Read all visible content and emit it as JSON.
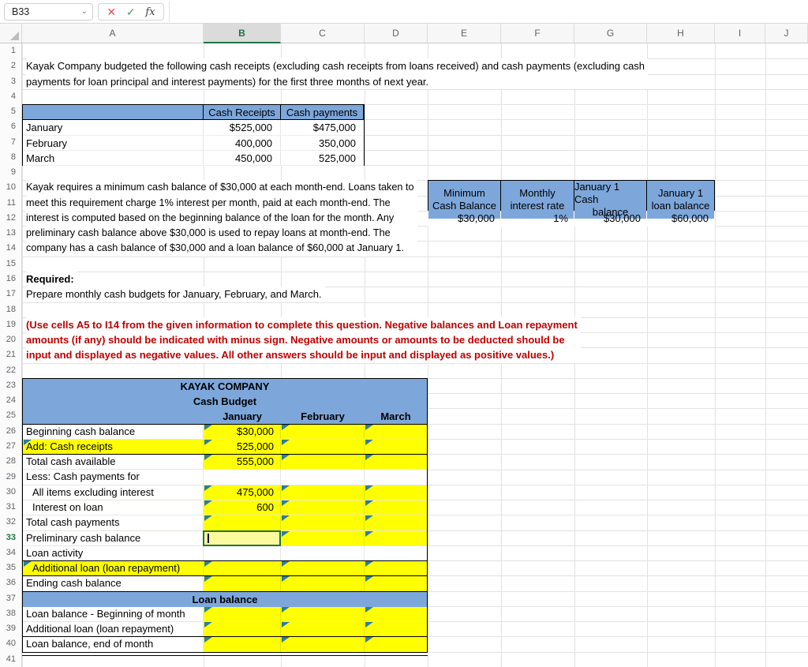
{
  "toolbar": {
    "name_box": "B33",
    "formula_value": "",
    "icons": {
      "chevron": "⌄",
      "cancel": "✕",
      "confirm": "✓",
      "function": "fx"
    }
  },
  "sheet": {
    "columns": [
      "A",
      "B",
      "C",
      "D",
      "E",
      "F",
      "G",
      "H",
      "I",
      "J"
    ],
    "selected_column": "B",
    "selected_row": 33,
    "row_count": 41
  },
  "colors": {
    "header_blue": "#7DA7DB",
    "input_yellow": "#FFFF00",
    "editing_yellow": "#FBFB9E",
    "flag_teal": "#2E7D9C",
    "selection_green": "#217346",
    "instruction_red": "#C00000"
  },
  "intro": {
    "line1": "Kayak Company budgeted the following cash receipts (excluding cash receipts from loans received) and cash payments (excluding cash",
    "line2": "payments for loan principal and interest payments) for the first three months of next year."
  },
  "receipts_table": {
    "header_receipts": "Cash Receipts",
    "header_payments": "Cash payments",
    "rows": [
      {
        "month": "January",
        "receipts": "$525,000",
        "payments": "$475,000"
      },
      {
        "month": "February",
        "receipts": "400,000",
        "payments": "350,000"
      },
      {
        "month": "March",
        "receipts": "450,000",
        "payments": "525,000"
      }
    ]
  },
  "note": {
    "lines": [
      "Kayak requires a minimum cash balance of $30,000 at each month-end. Loans taken to",
      "meet this requirement charge 1% interest per month, paid at each month-end. The",
      "interest is computed based on the beginning balance of the loan for the month. Any",
      "preliminary cash balance above $30,000 is used to repay loans at month-end. The",
      "company has a cash balance of $30,000 and a loan balance of $60,000 at January 1."
    ]
  },
  "info_table": {
    "cols": [
      {
        "l1": "Minimum",
        "l2": "Cash Balance",
        "value": "$30,000"
      },
      {
        "l1": "Monthly",
        "l2": "interest rate",
        "value": "1%"
      },
      {
        "l1": "January 1 Cash",
        "l2": "balance",
        "value": "$30,000"
      },
      {
        "l1": "January 1",
        "l2": "loan balance",
        "value": "$60,000"
      }
    ]
  },
  "required": {
    "heading": "Required:",
    "text": "Prepare monthly cash budgets for January, February, and March."
  },
  "instruction": {
    "lines": [
      "(Use cells A5 to I14 from the given information to complete this question. Negative balances and Loan repayment",
      "amounts (if any) should be indicated with minus sign. Negative amounts or amounts to be deducted should be",
      "input and displayed as negative values. All other answers should be input and displayed as positive values.)"
    ]
  },
  "budget": {
    "title": "KAYAK COMPANY",
    "subtitle": "Cash Budget",
    "months": [
      "January",
      "February",
      "March"
    ],
    "rows": [
      {
        "label": "Beginning cash balance",
        "jan": "$30,000",
        "feb": "",
        "mar": ""
      },
      {
        "label": "Add: Cash receipts",
        "jan": "525,000",
        "feb": "",
        "mar": ""
      },
      {
        "label": "Total cash available",
        "jan": "555,000",
        "feb": "",
        "mar": ""
      },
      {
        "label": "Less: Cash payments for",
        "jan": "",
        "feb": "",
        "mar": ""
      },
      {
        "label": "All items excluding interest",
        "jan": "475,000",
        "feb": "",
        "mar": ""
      },
      {
        "label": "Interest on loan",
        "jan": "600",
        "feb": "",
        "mar": ""
      },
      {
        "label": "Total cash payments",
        "jan": "",
        "feb": "",
        "mar": ""
      },
      {
        "label": "Preliminary cash balance",
        "jan": "",
        "feb": "",
        "mar": ""
      },
      {
        "label": "Loan activity",
        "jan": "",
        "feb": "",
        "mar": ""
      },
      {
        "label": "Additional loan (loan repayment)",
        "jan": "",
        "feb": "",
        "mar": ""
      },
      {
        "label": "Ending cash balance",
        "jan": "",
        "feb": "",
        "mar": ""
      }
    ],
    "loan_section": {
      "header": "Loan balance",
      "rows": [
        {
          "label": "Loan balance - Beginning of month",
          "jan": "",
          "feb": "",
          "mar": ""
        },
        {
          "label": "Additional loan (loan repayment)",
          "jan": "",
          "feb": "",
          "mar": ""
        },
        {
          "label": "Loan balance, end of month",
          "jan": "",
          "feb": "",
          "mar": ""
        }
      ]
    }
  }
}
